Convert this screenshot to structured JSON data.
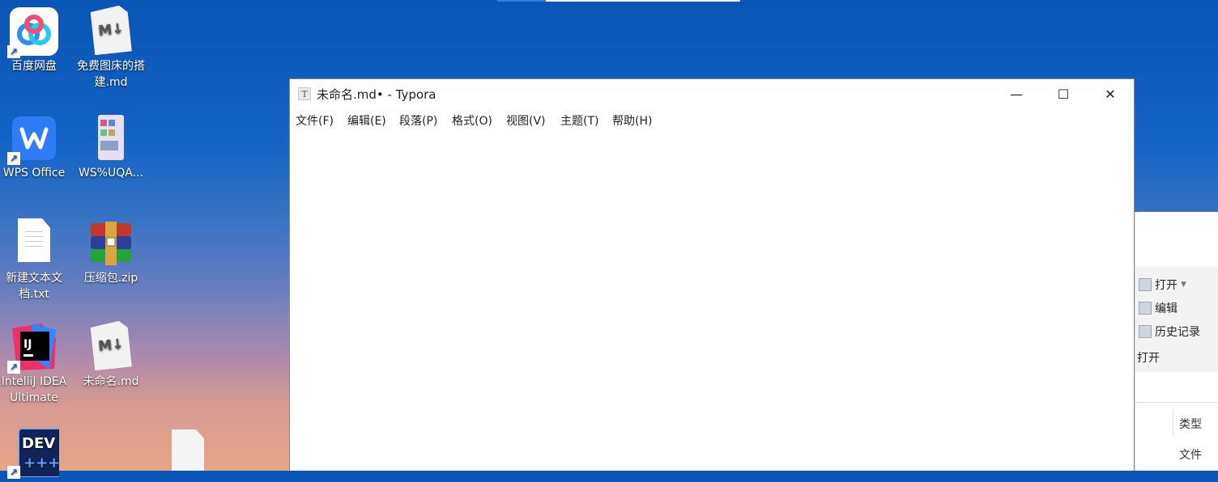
{
  "desktop": {
    "icons": [
      {
        "label": "百度网盘",
        "icon": "baidu-netdisk-icon"
      },
      {
        "label": "免费图床的搭建.md",
        "icon": "markdown-file-icon"
      },
      {
        "label": "WPS Office",
        "icon": "wps-office-icon"
      },
      {
        "label": "WS%UQA...",
        "icon": "image-file-icon"
      },
      {
        "label": "新建文本文档.txt",
        "icon": "text-file-icon"
      },
      {
        "label": "压缩包.zip",
        "icon": "zip-archive-icon"
      },
      {
        "label": "IntelliJ IDEA Ultimate",
        "icon": "intellij-idea-icon"
      },
      {
        "label": "未命名.md",
        "icon": "markdown-file-icon"
      },
      {
        "label": "",
        "icon": "dev-cpp-icon"
      }
    ]
  },
  "typora": {
    "title": "未命名.md• - Typora",
    "menu": [
      "文件(F)",
      "编辑(E)",
      "段落(P)",
      "格式(O)",
      "视图(V)",
      "主题(T)",
      "帮助(H)"
    ],
    "controls": {
      "minimize": "—",
      "maximize": "☐",
      "close": "✕"
    }
  },
  "bg_window": {
    "ribbon": {
      "open": "打开",
      "edit": "编辑",
      "history": "历史记录",
      "group_label": "打开"
    },
    "column_header": "类型",
    "row_value": "文件"
  }
}
